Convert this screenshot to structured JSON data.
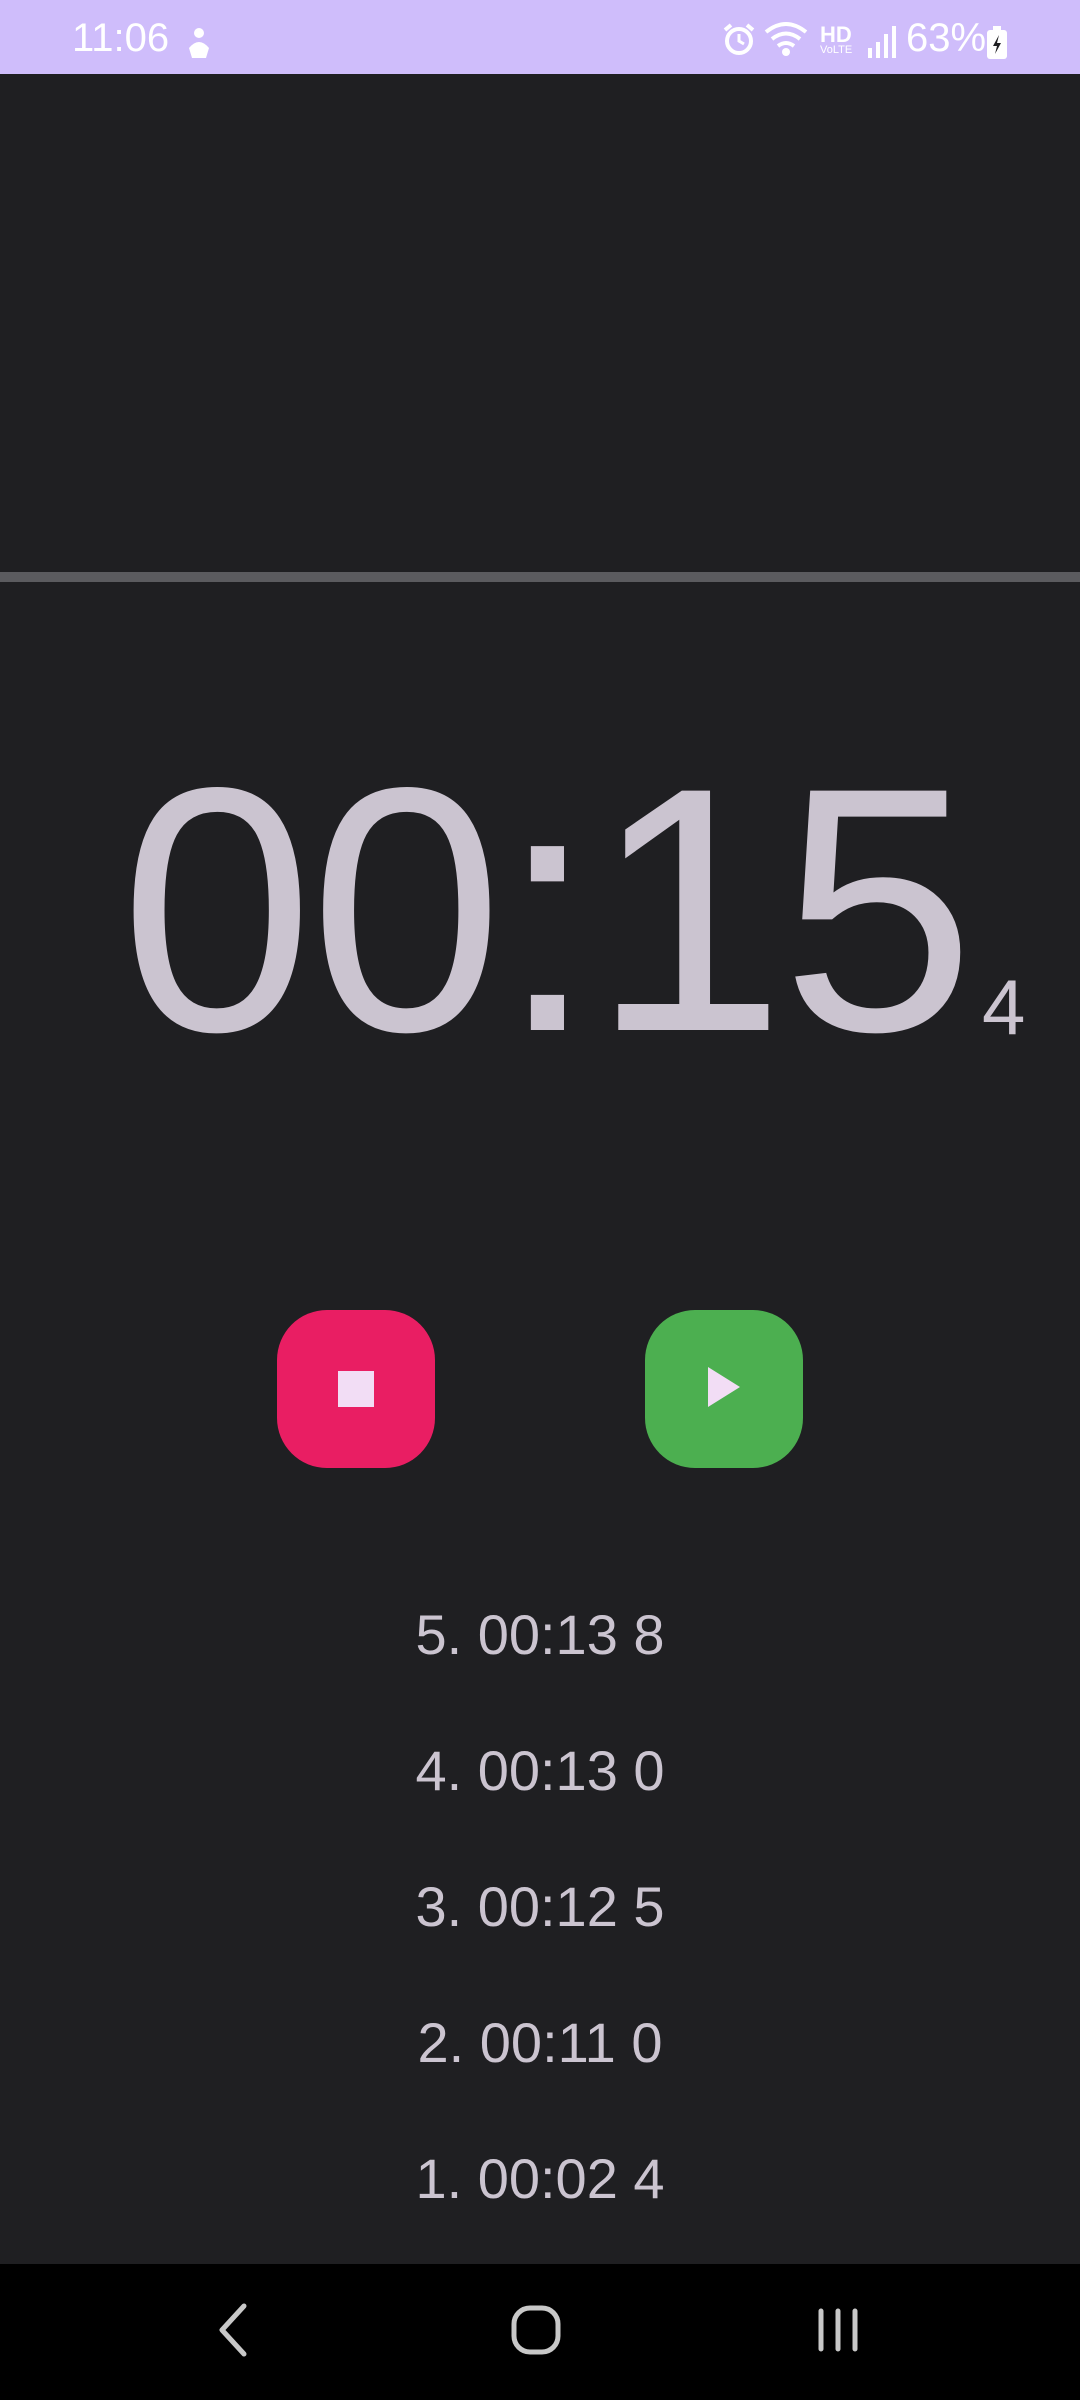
{
  "status_bar": {
    "time": "11:06",
    "battery_text": "63%",
    "hd_label": "HD",
    "voice_label": "VoLTE",
    "icons": [
      "person-icon",
      "alarm-icon",
      "wifi-icon",
      "signal-icon",
      "battery-icon"
    ],
    "background_color": "#cfbdfb"
  },
  "timer": {
    "main": "00:15",
    "fraction": "4"
  },
  "controls": {
    "stop_button_color": "#e91e63",
    "play_button_color": "#4caf50"
  },
  "laps": [
    "5. 00:13 8",
    "4. 00:13 0",
    "3. 00:12 5",
    "2. 00:11 0",
    "1. 00:02 4"
  ],
  "nav_bar": {
    "icons": [
      "back-icon",
      "home-icon",
      "recents-icon"
    ]
  }
}
